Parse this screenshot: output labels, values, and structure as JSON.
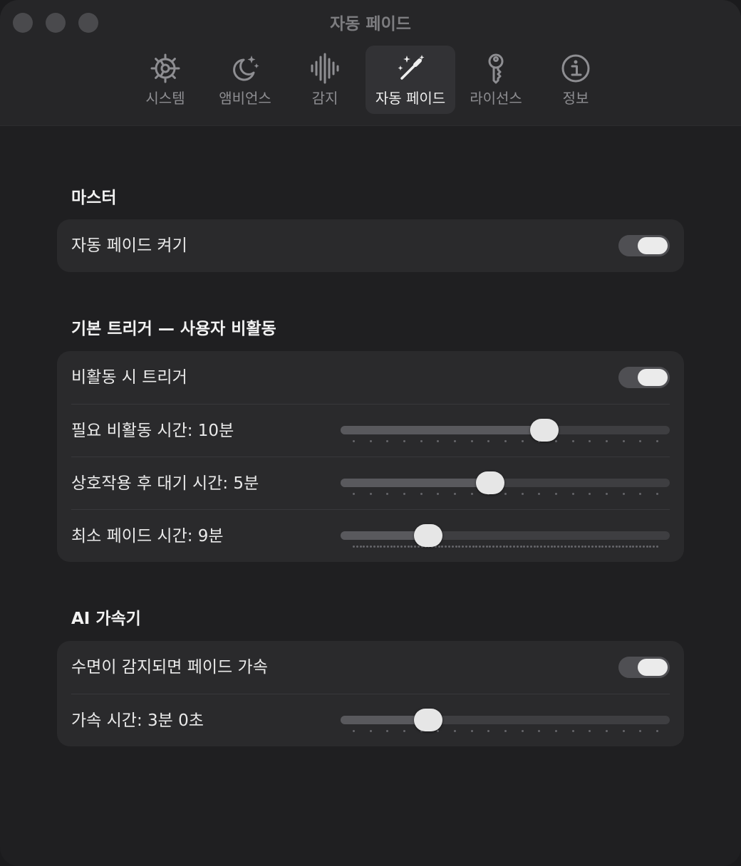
{
  "window": {
    "title": "자동 페이드"
  },
  "tabs": [
    {
      "label": "시스템",
      "icon": "gear-icon",
      "active": false
    },
    {
      "label": "앰비언스",
      "icon": "moon-stars-icon",
      "active": false
    },
    {
      "label": "감지",
      "icon": "waveform-icon",
      "active": false
    },
    {
      "label": "자동 페이드",
      "icon": "magic-wand-icon",
      "active": true
    },
    {
      "label": "라이선스",
      "icon": "key-icon",
      "active": false
    },
    {
      "label": "정보",
      "icon": "info-icon",
      "active": false
    }
  ],
  "sections": {
    "master": {
      "title": "마스터",
      "enable_label": "자동 페이드 켜기",
      "enable_on": true
    },
    "trigger": {
      "title": "기본 트리거 — 사용자 비활동",
      "toggle_label": "비활동 시 트리거",
      "toggle_on": true,
      "inactivity_label": "필요 비활동 시간: 10분",
      "inactivity_value": 0.63,
      "wait_label": "상호작용 후 대기 시간: 5분",
      "wait_value": 0.45,
      "minfade_label": "최소 페이드 시간: 9분",
      "minfade_value": 0.246
    },
    "ai": {
      "title": "AI 가속기",
      "toggle_label": "수면이 감지되면 페이드 가속",
      "toggle_on": true,
      "accel_label": "가속 시간: 3분 0초",
      "accel_value": 0.246
    }
  },
  "colors": {
    "background": "#1f1f21",
    "card": "#2a2a2c",
    "toggle_track": "#4f4f53",
    "knob": "#ebebeb"
  }
}
